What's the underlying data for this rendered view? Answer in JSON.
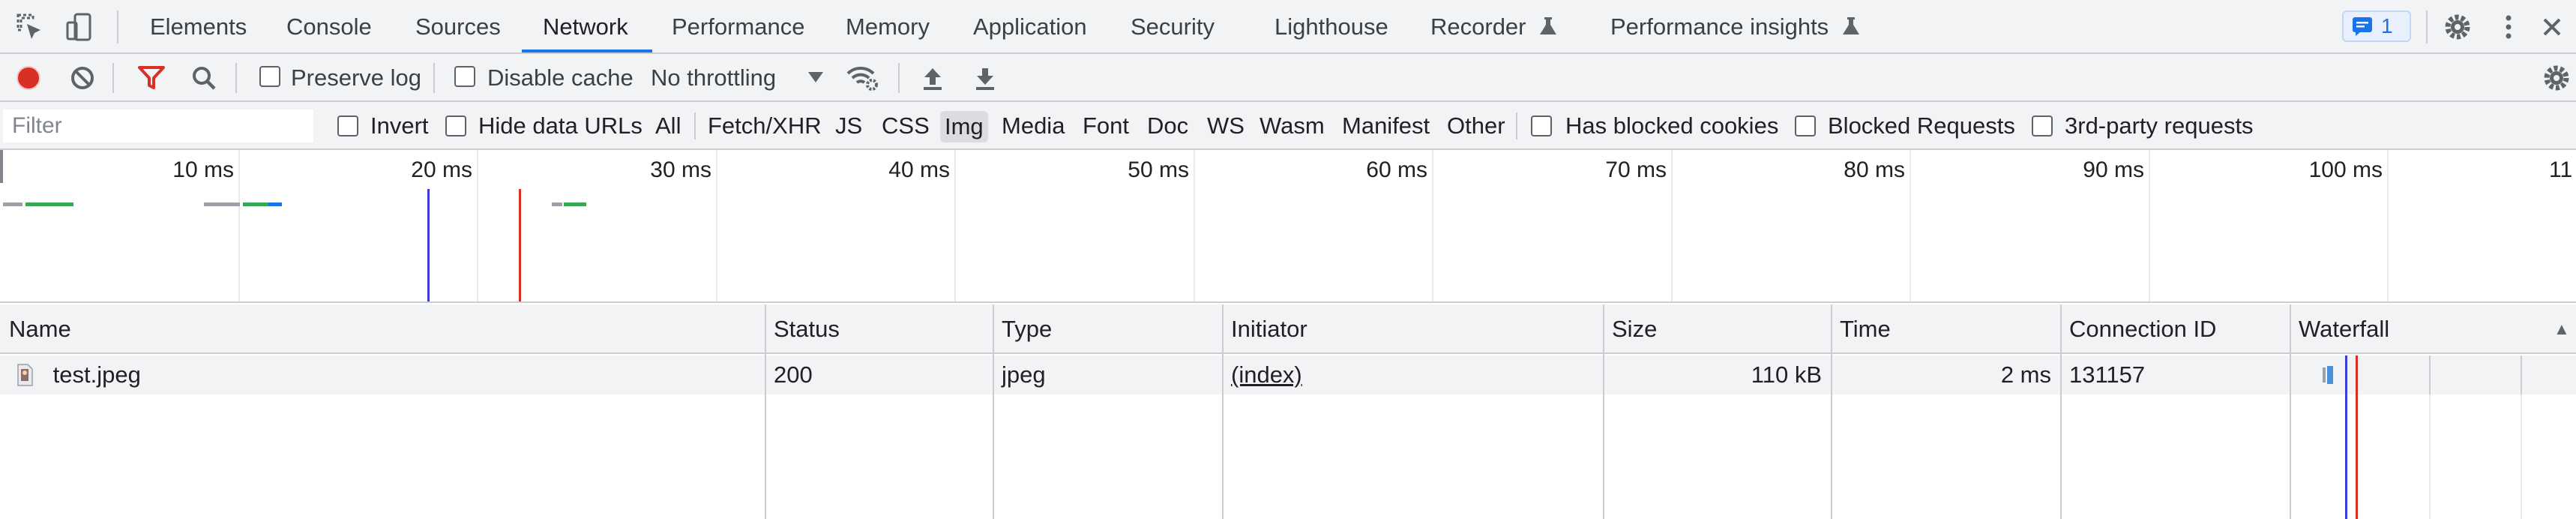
{
  "tabs": [
    {
      "label": "Elements",
      "active": false
    },
    {
      "label": "Console",
      "active": false
    },
    {
      "label": "Sources",
      "active": false
    },
    {
      "label": "Network",
      "active": true
    },
    {
      "label": "Performance",
      "active": false
    },
    {
      "label": "Memory",
      "active": false
    },
    {
      "label": "Application",
      "active": false
    },
    {
      "label": "Security",
      "active": false
    },
    {
      "label": "Lighthouse",
      "active": false
    },
    {
      "label": "Recorder",
      "active": false,
      "experimental": true
    },
    {
      "label": "Performance insights",
      "active": false,
      "experimental": true
    }
  ],
  "issues_badge": {
    "count": "1",
    "icon": "message-icon"
  },
  "toolbar": {
    "preserve_log_label": "Preserve log",
    "preserve_log_checked": false,
    "disable_cache_label": "Disable cache",
    "disable_cache_checked": false,
    "throttling_value": "No throttling"
  },
  "filter": {
    "placeholder": "Filter",
    "value": "",
    "invert_label": "Invert",
    "hide_data_urls_label": "Hide data URLs",
    "types": [
      {
        "label": "All",
        "selected": false
      },
      {
        "label": "Fetch/XHR",
        "selected": false
      },
      {
        "label": "JS",
        "selected": false
      },
      {
        "label": "CSS",
        "selected": false
      },
      {
        "label": "Img",
        "selected": true
      },
      {
        "label": "Media",
        "selected": false
      },
      {
        "label": "Font",
        "selected": false
      },
      {
        "label": "Doc",
        "selected": false
      },
      {
        "label": "WS",
        "selected": false
      },
      {
        "label": "Wasm",
        "selected": false
      },
      {
        "label": "Manifest",
        "selected": false
      },
      {
        "label": "Other",
        "selected": false
      }
    ],
    "blocked_cookies_label": "Has blocked cookies",
    "blocked_requests_label": "Blocked Requests",
    "third_party_label": "3rd-party requests"
  },
  "overview": {
    "tick_labels": [
      "10 ms",
      "20 ms",
      "30 ms",
      "40 ms",
      "50 ms",
      "60 ms",
      "70 ms",
      "80 ms",
      "90 ms",
      "100 ms",
      "11"
    ],
    "dom_content_loaded_color": "#3c3cd6",
    "load_color": "#d93025"
  },
  "table": {
    "columns": {
      "name": "Name",
      "status": "Status",
      "type": "Type",
      "initiator": "Initiator",
      "size": "Size",
      "time": "Time",
      "connection_id": "Connection ID",
      "waterfall": "Waterfall"
    },
    "sort_indicator": "▲",
    "rows": [
      {
        "name": "test.jpeg",
        "icon": "image-file-icon",
        "status": "200",
        "type": "jpeg",
        "initiator": "(index)",
        "size": "110 kB",
        "time": "2 ms",
        "connection_id": "131157"
      }
    ]
  },
  "colors": {
    "accent": "#1a73e8",
    "record": "#d93025",
    "filter_icon": "#d93025"
  }
}
